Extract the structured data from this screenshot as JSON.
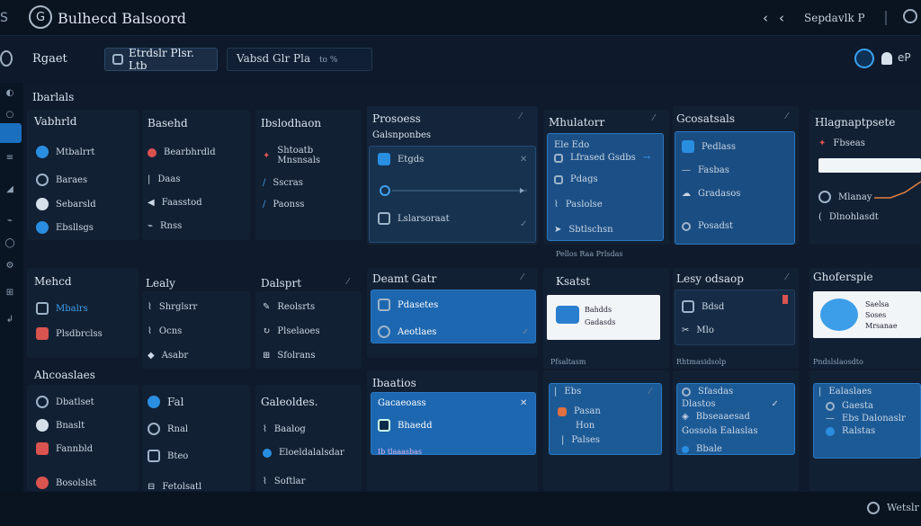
{
  "app": {
    "title": "Bulhecd Balsoord",
    "logo": "G"
  },
  "titlebar": {
    "back1": "‹",
    "back2": "‹",
    "search": "Sepdavlk P"
  },
  "toolbar": {
    "page_label": "Rgaet",
    "tab_a": "Etrdslr Plsr. Ltb",
    "tab_b": "Vabsd Glr Pla",
    "tab_b_suffix": "to %"
  },
  "sidebar": {
    "section1_title": "Ibarlals",
    "sections": [
      {
        "title": "Vabhrld",
        "items": [
          "Mtbalrrt",
          "Baraes",
          "Sebarsld",
          "Ebsllsgs"
        ]
      },
      {
        "title": "Mehcd",
        "items": [
          "Mbalrs",
          "Plsdbrclss"
        ]
      },
      {
        "title": "Ahcoaslaes",
        "items": [
          "Dbatlset",
          "Bnaslt",
          "Fannbld",
          "Bosolslst"
        ]
      }
    ]
  },
  "col2": [
    {
      "title": "Basehd",
      "items": [
        "Bearbhrdld",
        "Daas",
        "Faasstod",
        "Rnss"
      ]
    },
    {
      "title": "Lealy",
      "items": [
        "Shrglsrr",
        "Ocns",
        "Asabr"
      ]
    },
    {
      "title": "Fal",
      "items": [
        "Rnal",
        "Bteo",
        "Fetolsatl"
      ]
    }
  ],
  "col3": [
    {
      "title": "Ibslodhaon",
      "items": [
        "Shtoatb Mnsnsals",
        "Sscras",
        "Paonss"
      ]
    },
    {
      "title": "Dalsprt",
      "items": [
        "Reolsrts",
        "Plselaoes",
        "Sfolrans"
      ]
    },
    {
      "title": "Galeoldes.",
      "items": [
        "Baalog",
        "Eloeldalalsdar",
        "Softlar"
      ]
    }
  ],
  "panel_processes": {
    "title": "Prosoess",
    "subtitle": "Galsnponbes",
    "rows": [
      "Etgds",
      "Lslarsoraat"
    ]
  },
  "panel_mhulator": {
    "title": "Mhulatorr",
    "rows": [
      "Ele Edo",
      "Lfrased Gsdbs",
      "Pdags",
      "Paslolse",
      "Sbtlschsn"
    ],
    "footer": "Pellos Raa Prlsdas"
  },
  "panel_geospatl": {
    "title": "Gcosatsals",
    "rows": [
      "Pedlass",
      "Fasbas",
      "Gradasos",
      "Posadst"
    ]
  },
  "panel_hlspace": {
    "title": "Hlagnaptpsete",
    "rows": [
      "Fbseas",
      "Mlanay",
      "Dlnohlasdt"
    ]
  },
  "panel_doamt": {
    "title": "Deamt Gatr",
    "rows": [
      "Pdasetes",
      "Aeotlaes"
    ]
  },
  "panel_ksatst": {
    "title": "Ksatst",
    "card": {
      "line1": "Bahdds",
      "line2": "Gadasds"
    },
    "footer": "Pfsaltasm"
  },
  "panel_lesy": {
    "title": "Lesy odsaop",
    "rows": [
      "Bdsd",
      "Mlo"
    ],
    "footer": "Rhtmasidsolp"
  },
  "panel_ghoferspie": {
    "title": "Ghoferspie",
    "card": {
      "line1": "Saelsa",
      "line2": "Soses",
      "line3": "Mrsanae"
    },
    "footer": "Pndslslaosdto"
  },
  "panel_ibaatios": {
    "title": "Ibaatios",
    "card_title": "Gacaeoass",
    "rows": [
      "Bhaedd",
      "Ib tlaaasbas"
    ]
  },
  "panel_bottom2": {
    "rows": [
      "Ebs",
      "Pasan",
      "Hon",
      "Palses"
    ]
  },
  "panel_bottom3": {
    "rows": [
      "Sfasdas",
      "Dlastos",
      "Bbseaaesad",
      "Gossola Ealaslas",
      "Bbale"
    ]
  },
  "panel_bottom4": {
    "rows": [
      "Ealaslaes",
      "Gaesta",
      "Ebs Dalonaslr",
      "Ralstas"
    ]
  },
  "footer": {
    "label": "Wetslr"
  },
  "colors": {
    "accent": "#2a8ee0",
    "card_blue": "#1d5e9e",
    "bg": "#0f1b2c"
  }
}
